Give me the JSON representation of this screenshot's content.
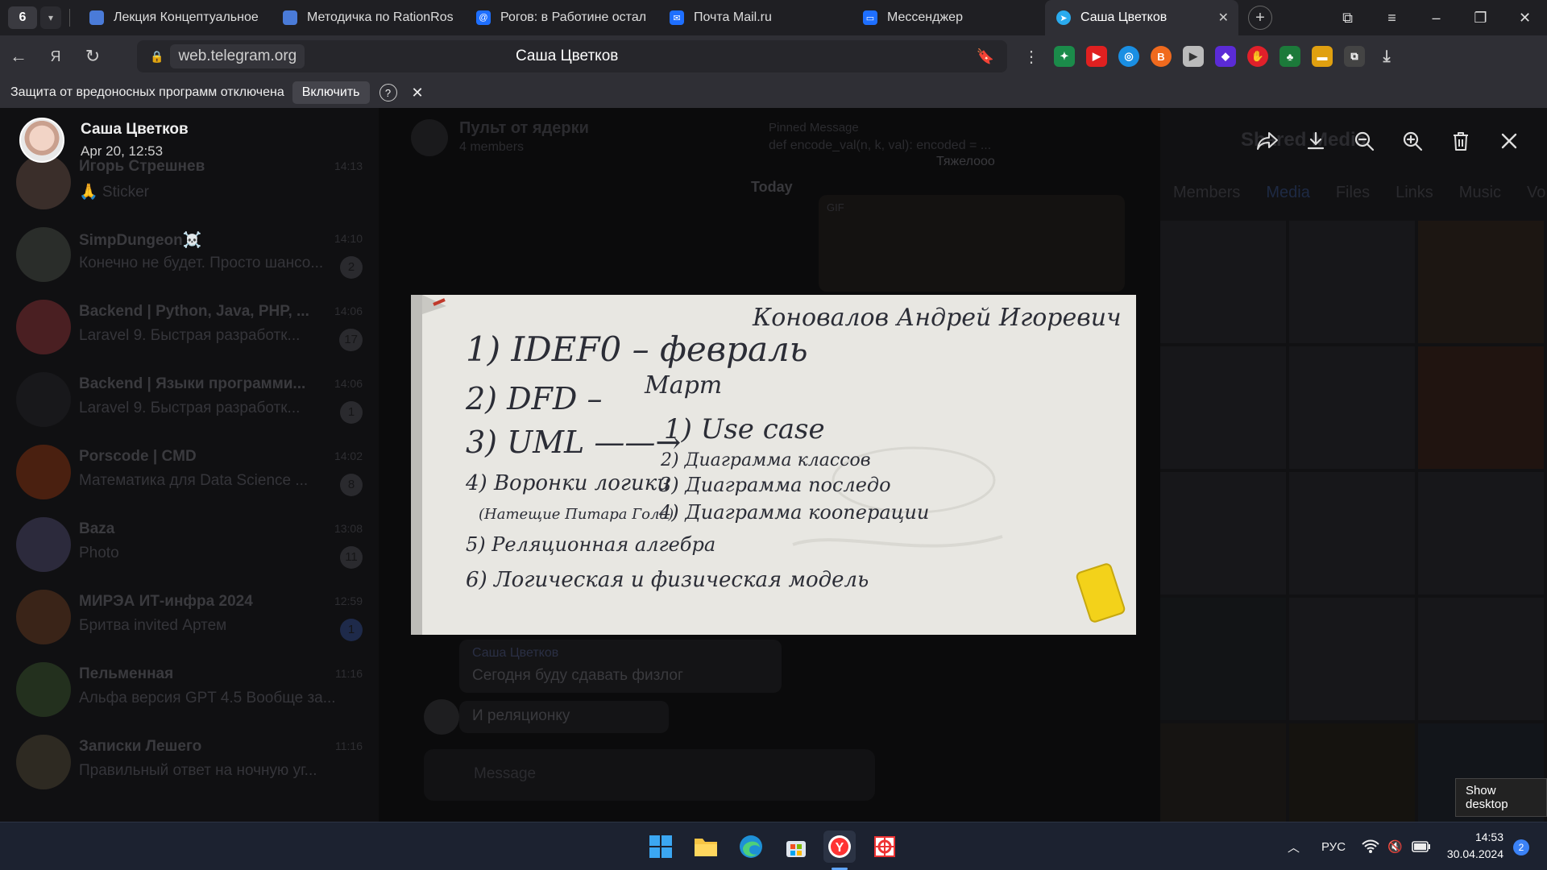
{
  "browser": {
    "tab_count": "6",
    "tabs": [
      {
        "label": "Лекция Концептуальное",
        "icon": "doc-blue-icon",
        "color": "#4a7bd8"
      },
      {
        "label": "Методичка по RationRose",
        "icon": "doc-blue-icon",
        "color": "#4a7bd8"
      },
      {
        "label": "Рогов: в Работине остал",
        "icon": "at-sign-icon",
        "color": "#1e6fff"
      },
      {
        "label": "Почта Mail.ru",
        "icon": "mail-icon",
        "color": "#1e6fff"
      },
      {
        "label": "Мессенджер",
        "icon": "messenger-icon",
        "color": "#1e6fff"
      },
      {
        "label": "Саша Цветков",
        "icon": "telegram-icon",
        "color": "#2aabee"
      }
    ],
    "url": "web.telegram.org",
    "page_title": "Саша Цветков",
    "protection_message": "Защита от вредоносных программ отключена",
    "protection_button": "Включить",
    "help_label": "?"
  },
  "sidebar": {
    "chats": [
      {
        "name": "Игорь Стрешнев",
        "preview": "🙏 Sticker",
        "time": "14:13",
        "badge": "",
        "color": "#3a2e2a"
      },
      {
        "name": "SimpDungeon☠️",
        "preview": "Конечно не будет. Просто шансо...",
        "time": "14:10",
        "badge": "2",
        "color": "#2a2d2a"
      },
      {
        "name": "Backend | Python, Java, PHP, ...",
        "preview": "Laravel 9. Быстрая разработк...",
        "time": "14:06",
        "badge": "17",
        "color": "#4a1f22"
      },
      {
        "name": "Backend | Языки программи...",
        "preview": "Laravel 9. Быстрая разработк...",
        "time": "14:06",
        "badge": "1",
        "color": "#18181b"
      },
      {
        "name": "Porscode | CMD",
        "preview": "Математика для Data Science ...",
        "time": "14:02",
        "badge": "8",
        "color": "#4a2010"
      },
      {
        "name": "Baza",
        "preview": "Photo",
        "time": "13:08",
        "badge": "11",
        "color": "#2c2a3c"
      },
      {
        "name": "МИРЭА ИТ-инфра 2024",
        "preview": "Бритва invited Артем",
        "time": "12:59",
        "badge": "1",
        "color": "#3a2418"
      },
      {
        "name": "Пельменная",
        "preview": "Альфа версия GPT 4.5 Вообще за...",
        "time": "11:16",
        "badge": "",
        "color": "#23301e"
      },
      {
        "name": "Записки Лешего",
        "preview": "Правильный ответ на ночную уг...",
        "time": "11:16",
        "badge": "",
        "color": "#2e2a22"
      }
    ]
  },
  "center": {
    "chat_title": "Пульт от ядерки",
    "members": "4 members",
    "pinned_label": "Pinned Message",
    "pinned_text": "def encode_val(n, k, val): encoded = ...",
    "date_sep": "Today",
    "msg_top": "Тяжелооо",
    "msg_sender": "Саша Цветков",
    "msg1": "Сегодня буду сдавать физлог",
    "msg2": "И реляционку",
    "input_placeholder": "Message",
    "gif_label": "GIF"
  },
  "right": {
    "title": "Shared Media",
    "tabs": [
      "Members",
      "Media",
      "Files",
      "Links",
      "Music",
      "Vo"
    ]
  },
  "viewer": {
    "sender": "Саша Цветков",
    "date": "Apr 20, 12:53"
  },
  "whiteboard": {
    "header": "Коновалов Андрей Игоревич",
    "lines": [
      "1) IDEF0 – февраль",
      "2) DFD –",
      "Март",
      "3) UML ——→",
      "1) Use case",
      "2) Диаграмма классов",
      "4) Воронки логики",
      "3) Диаграмма последо",
      "(Натещие Питара Гола)",
      "4) Диаграмма кооперации",
      "5) Реляционная алгебра",
      "6) Логическая и физическая модель"
    ]
  },
  "taskbar": {
    "lang": "РУС",
    "time": "14:53",
    "date": "30.04.2024",
    "notifications": "2",
    "show_desktop": "Show desktop"
  }
}
